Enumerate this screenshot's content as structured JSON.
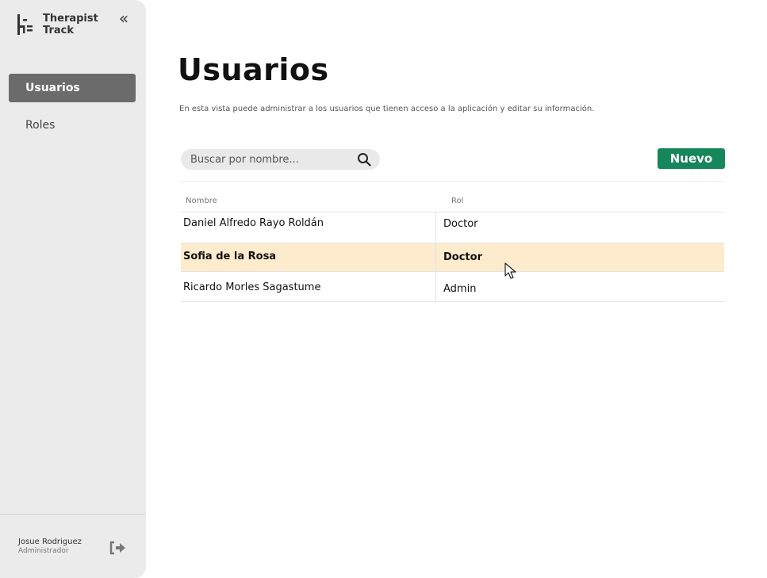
{
  "app": {
    "name_line1": "Therapist",
    "name_line2": "Track"
  },
  "sidebar": {
    "collapse_icon": "«",
    "items": [
      {
        "label": "Usuarios",
        "active": true
      },
      {
        "label": "Roles",
        "active": false
      }
    ],
    "user": {
      "name": "Josue Rodriguez",
      "role": "Administrador"
    }
  },
  "main": {
    "title": "Usuarios",
    "description": "En esta vista puede administrar a los usuarios que tienen acceso a la aplicación y editar su información.",
    "search": {
      "placeholder": "Buscar por nombre..."
    },
    "new_button": "Nuevo",
    "table": {
      "headers": [
        "Nombre",
        "Rol"
      ],
      "rows": [
        {
          "nombre": "Daniel Alfredo Rayo Roldán",
          "rol": "Doctor"
        },
        {
          "nombre": "Sofia de la Rosa",
          "rol": "Doctor"
        },
        {
          "nombre": "Ricardo Morles Sagastume",
          "rol": "Admin"
        }
      ]
    }
  },
  "colors": {
    "sidebar_bg": "#ebebeb",
    "active_nav": "#6b6b6b",
    "accent_green": "#16875a",
    "row_highlight": "#fcebcd"
  },
  "icons": [
    "logo-icon",
    "collapse-icon",
    "search-icon",
    "logout-icon",
    "mouse-cursor-icon"
  ]
}
